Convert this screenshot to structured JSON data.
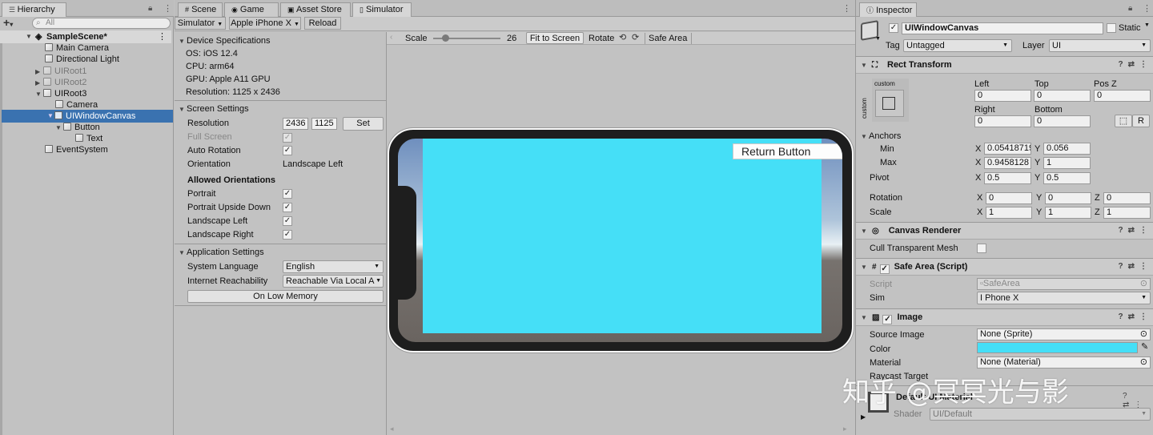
{
  "hierarchy": {
    "tab": "Hierarchy",
    "search_placeholder": "All",
    "add_label": "+",
    "items": [
      {
        "label": "SampleScene*",
        "indent": 0
      },
      {
        "label": "Main Camera",
        "indent": 1
      },
      {
        "label": "Directional Light",
        "indent": 1
      },
      {
        "label": "UIRoot1",
        "indent": 1
      },
      {
        "label": "UIRoot2",
        "indent": 1
      },
      {
        "label": "UIRoot3",
        "indent": 1
      },
      {
        "label": "Camera",
        "indent": 2
      },
      {
        "label": "UIWindowCanvas",
        "indent": 2
      },
      {
        "label": "Button",
        "indent": 3
      },
      {
        "label": "Text",
        "indent": 4
      },
      {
        "label": "EventSystem",
        "indent": 1
      }
    ]
  },
  "center_tabs": [
    "Scene",
    "Game",
    "Asset Store",
    "Simulator"
  ],
  "toolbar": {
    "simulator": "Simulator",
    "device": "Apple iPhone X",
    "reload": "Reload"
  },
  "device_specs": {
    "title": "Device Specifications",
    "os": "OS: iOS 12.4",
    "cpu": "CPU: arm64",
    "gpu": "GPU: Apple A11 GPU",
    "resolution": "Resolution: 1125 x 2436"
  },
  "screen_settings": {
    "title": "Screen Settings",
    "resolution_label": "Resolution",
    "res_w": "2436",
    "res_h": "1125",
    "set": "Set",
    "full_screen": "Full Screen",
    "auto_rotation": "Auto Rotation",
    "orientation_label": "Orientation",
    "orientation_value": "Landscape Left",
    "allowed_title": "Allowed Orientations",
    "portrait": "Portrait",
    "portrait_upside": "Portrait Upside Down",
    "landscape_left": "Landscape Left",
    "landscape_right": "Landscape Right"
  },
  "app_settings": {
    "title": "Application Settings",
    "language_label": "System Language",
    "language_value": "English",
    "reach_label": "Internet Reachability",
    "reach_value": "Reachable Via Local A",
    "low_memory": "On Low Memory"
  },
  "sim_toolbar": {
    "scale_label": "Scale",
    "scale_value": "26",
    "fit": "Fit to Screen",
    "rotate": "Rotate",
    "safe_area": "Safe Area",
    "scale_fraction": 0.18
  },
  "device_screen": {
    "button_label": "Return Button",
    "canvas_color": "#45dff7"
  },
  "inspector": {
    "tab": "Inspector",
    "name": "UIWindowCanvas",
    "static": "Static",
    "tag_label": "Tag",
    "tag": "Untagged",
    "layer_label": "Layer",
    "layer": "UI",
    "rect_transform": {
      "title": "Rect Transform",
      "custom": "custom",
      "custom_side": "custom",
      "left_label": "Left",
      "top_label": "Top",
      "posz_label": "Pos Z",
      "left": "0",
      "top": "0",
      "posz": "0",
      "right_label": "Right",
      "bottom_label": "Bottom",
      "right": "0",
      "bottom": "0",
      "r_btn": "R",
      "anchors": "Anchors",
      "min": "Min",
      "max": "Max",
      "x": "X",
      "y": "Y",
      "z": "Z",
      "min_x": "0.05418719",
      "min_y": "0.056",
      "max_x": "0.9458128",
      "max_y": "1",
      "pivot": "Pivot",
      "pivot_x": "0.5",
      "pivot_y": "0.5",
      "rotation": "Rotation",
      "rot_x": "0",
      "rot_y": "0",
      "rot_z": "0",
      "scale": "Scale",
      "sc_x": "1",
      "sc_y": "1",
      "sc_z": "1"
    },
    "canvas_renderer": {
      "title": "Canvas Renderer",
      "cull": "Cull Transparent Mesh"
    },
    "safe_area": {
      "title": "Safe Area (Script)",
      "script_label": "Script",
      "script": "SafeArea",
      "sim_label": "Sim",
      "sim": "I Phone X"
    },
    "image": {
      "title": "Image",
      "source_label": "Source Image",
      "source": "None (Sprite)",
      "color_label": "Color",
      "color": "#45dff7",
      "material_label": "Material",
      "material": "None (Material)",
      "raycast_label": "Raycast Target"
    },
    "default_material": {
      "title": "Default UI Material",
      "shader_label": "Shader",
      "shader": "UI/Default"
    }
  },
  "watermark": "知乎 @冥冥光与影"
}
